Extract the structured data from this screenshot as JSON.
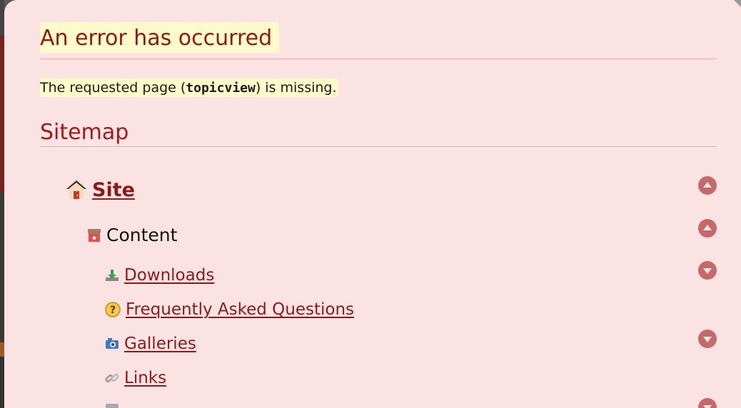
{
  "error": {
    "title": "An error has occurred",
    "message_prefix": "The requested page (",
    "page_name": "topicview",
    "message_suffix": ") is missing."
  },
  "sitemap": {
    "title": "Sitemap",
    "site": {
      "label": "Site",
      "icon": "house-icon",
      "toggle": "collapse"
    },
    "content": {
      "label": "Content",
      "icon": "content-box-icon",
      "toggle": "collapse"
    },
    "items": [
      {
        "label": "Downloads",
        "icon": "download-icon",
        "toggle": "expand"
      },
      {
        "label": "Frequently Asked Questions",
        "icon": "question-icon",
        "toggle": null
      },
      {
        "label": "Galleries",
        "icon": "camera-icon",
        "toggle": "expand"
      },
      {
        "label": "Links",
        "icon": "link-icon",
        "toggle": null
      }
    ]
  },
  "colors": {
    "background": "#fbe3e3",
    "heading": "#9b1c1c",
    "link": "#8b1a1a",
    "highlight": "#fdfbc9",
    "toggle": "#c46a6a"
  }
}
